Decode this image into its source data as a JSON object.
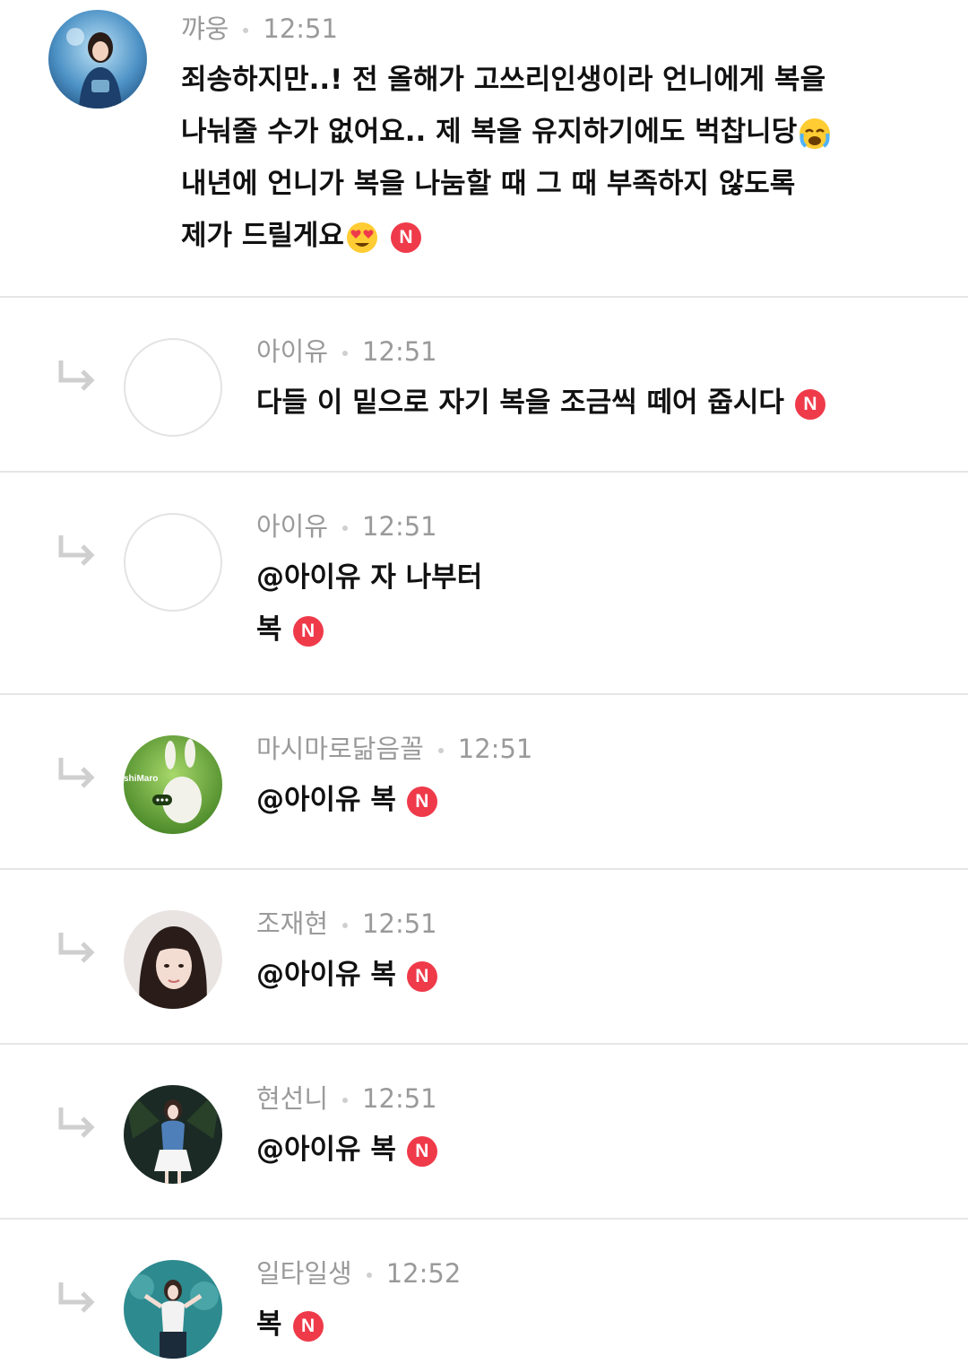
{
  "comments": [
    {
      "author": "꺄웅",
      "time": "12:51",
      "lines": [
        "죄송하지만..! 전 올해가 고쓰리인생이라 언니에게 복을",
        "나눠줄 수가 없어요.. 제 복을 유지하기에도 벅찹니당",
        "내년에 언니가 복을 나눔할 때 그 때 부족하지 않도록",
        "제가 드릴게요"
      ],
      "emoji_1": "crying-face-emoji",
      "emoji_2": "heart-eyes-emoji",
      "badge": "N"
    },
    {
      "author": "아이유",
      "time": "12:51",
      "lines": [
        "다들 이 밑으로 자기 복을 조금씩 떼어 줍시다"
      ],
      "badge": "N"
    },
    {
      "author": "아이유",
      "time": "12:51",
      "lines": [
        "@아이유 자 나부터",
        "복"
      ],
      "badge": "N"
    },
    {
      "author": "마시마로닮음꼴",
      "time": "12:51",
      "lines": [
        "@아이유 복"
      ],
      "badge": "N",
      "avatar_text": "shiMaro"
    },
    {
      "author": "조재현",
      "time": "12:51",
      "lines": [
        "@아이유 복"
      ],
      "badge": "N"
    },
    {
      "author": "현선니",
      "time": "12:51",
      "lines": [
        "@아이유 복"
      ],
      "badge": "N"
    },
    {
      "author": "일타일생",
      "time": "12:52",
      "lines": [
        "복"
      ],
      "badge": "N"
    }
  ],
  "colors": {
    "badge": "#ef3a4a",
    "meta_text": "#9a9a9a",
    "divider": "#e6e6e6",
    "reply_arrow": "#cfcfcf"
  },
  "icons": {
    "reply": "reply-arrow-icon",
    "new": "new-badge-icon"
  }
}
